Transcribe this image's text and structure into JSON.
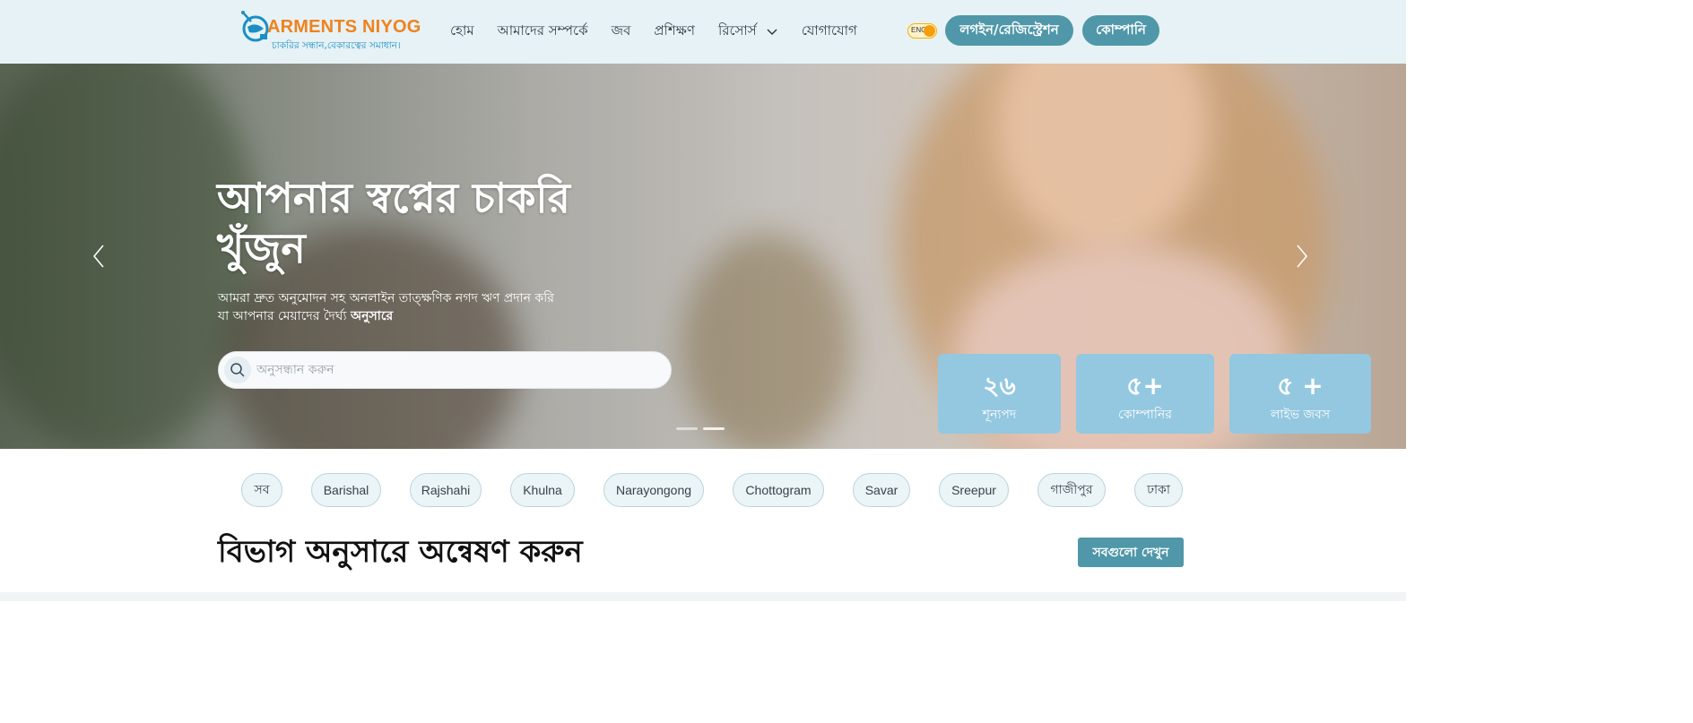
{
  "brand": {
    "title": "ARMENTS NIYOG",
    "tagline": "চাকরির সন্ধান,বেকারত্বের সমাধান।",
    "logo_icon": "g-globe-logo-icon",
    "title_color": "#f0821e",
    "tagline_color": "#1b8fc4"
  },
  "nav": {
    "items": [
      {
        "label": "হোম"
      },
      {
        "label": "আমাদের সম্পর্কে"
      },
      {
        "label": "জব"
      },
      {
        "label": "প্রশিক্ষণ"
      },
      {
        "label": "রিসোর্স",
        "has_dropdown": true
      },
      {
        "label": "যোগাযোগ"
      }
    ],
    "lang_toggle_label": "ENG",
    "login_label": "লগইন/রেজিস্ট্রেশন",
    "company_label": "কোম্পানি",
    "accent": "#4f97a9"
  },
  "hero": {
    "title": "আপনার স্বপ্নের চাকরি খুঁজুন",
    "subtitle_plain": "আমরা দ্রুত অনুমোদন সহ অনলাইন তাত্ক্ষণিক নগদ ঋণ প্রদান করি যা আপনার মেয়াদের দৈর্ঘ্য ",
    "subtitle_bold": "অনুসারে",
    "search_placeholder": "অনুসন্ধান করুন",
    "slide_count": 2
  },
  "stats": [
    {
      "value": "২৬",
      "label": "শূন্যপদ"
    },
    {
      "value": "৫+",
      "label": "কোম্পানির"
    },
    {
      "value": "৫ +",
      "label": "লাইভ জবস"
    }
  ],
  "chips": [
    "সব",
    "Barishal",
    "Rajshahi",
    "Khulna",
    "Narayongong",
    "Chottogram",
    "Savar",
    "Sreepur",
    "গাজীপুর",
    "ঢাকা"
  ],
  "section": {
    "title": "বিভাগ অনুসারে অন্বেষণ করুন",
    "view_all_label": "সবগুলো দেখুন"
  }
}
